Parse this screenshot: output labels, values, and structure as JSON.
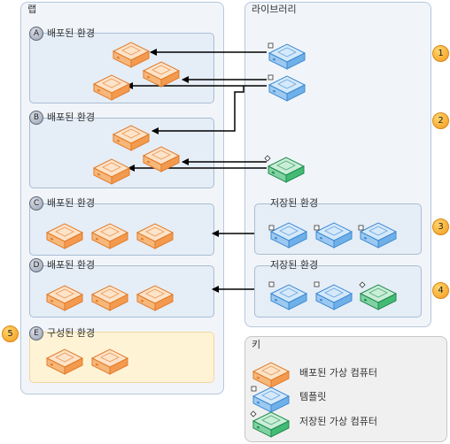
{
  "lab": {
    "title": "랩"
  },
  "library": {
    "title": "라이브러리"
  },
  "environments": [
    {
      "letter": "A",
      "label": "배포된 환경"
    },
    {
      "letter": "B",
      "label": "배포된 환경"
    },
    {
      "letter": "C",
      "label": "배포된 환경"
    },
    {
      "letter": "D",
      "label": "배포된 환경"
    },
    {
      "letter": "E",
      "label": "구성된 환경"
    }
  ],
  "stored_environments": [
    {
      "label": "저장된 환경"
    },
    {
      "label": "저장된 환경"
    }
  ],
  "steps": [
    "1",
    "2",
    "3",
    "4",
    "5"
  ],
  "key": {
    "title": "키",
    "items": [
      {
        "label": "배포된 가상 컴퓨터",
        "icon": "deployed-vm-icon"
      },
      {
        "label": "템플릿",
        "icon": "template-icon"
      },
      {
        "label": "저장된 가상 컴퓨터",
        "icon": "stored-vm-icon"
      }
    ]
  },
  "colors": {
    "deployed": "#f7a35c",
    "template": "#5aa2e0",
    "stored": "#36b36a",
    "step": "#f39a1c"
  }
}
